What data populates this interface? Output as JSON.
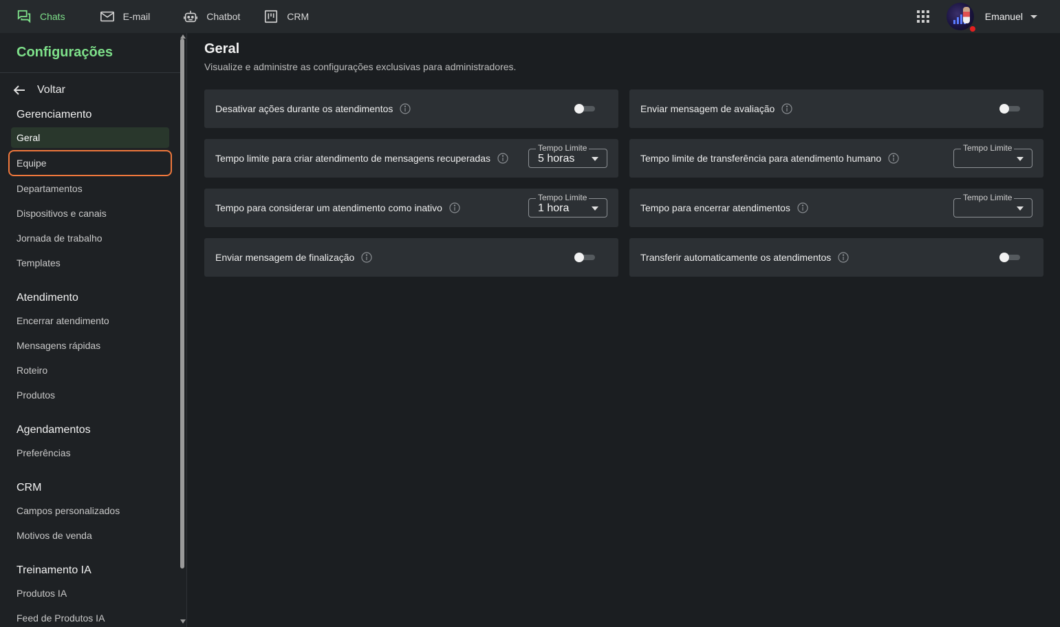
{
  "topbar": {
    "items": [
      {
        "label": "Chats",
        "icon": "chat-bubbles-icon",
        "active": true
      },
      {
        "label": "E-mail",
        "icon": "mail-icon",
        "active": false
      },
      {
        "label": "Chatbot",
        "icon": "robot-icon",
        "active": false
      },
      {
        "label": "CRM",
        "icon": "kanban-icon",
        "active": false
      }
    ],
    "user_name": "Emanuel"
  },
  "sidebar": {
    "title": "Configurações",
    "back_label": "Voltar",
    "sections": [
      {
        "title": "Gerenciamento",
        "items": [
          "Geral",
          "Equipe",
          "Departamentos",
          "Dispositivos e canais",
          "Jornada de trabalho",
          "Templates"
        ]
      },
      {
        "title": "Atendimento",
        "items": [
          "Encerrar atendimento",
          "Mensagens rápidas",
          "Roteiro",
          "Produtos"
        ]
      },
      {
        "title": "Agendamentos",
        "items": [
          "Preferências"
        ]
      },
      {
        "title": "CRM",
        "items": [
          "Campos personalizados",
          "Motivos de venda"
        ]
      },
      {
        "title": "Treinamento IA",
        "items": [
          "Produtos IA",
          "Feed de Produtos IA"
        ]
      }
    ],
    "selected_item": "Geral",
    "highlighted_item": "Equipe"
  },
  "main": {
    "title": "Geral",
    "subtitle": "Visualize e administre as configurações exclusivas para administradores.",
    "settings": [
      {
        "label": "Desativar ações durante os atendimentos",
        "control": "toggle",
        "enabled": false
      },
      {
        "label": "Enviar mensagem de avaliação",
        "control": "toggle",
        "enabled": false
      },
      {
        "label": "Tempo limite para criar atendimento de mensagens recuperadas",
        "control": "select",
        "select_label": "Tempo Limite",
        "value": "5 horas"
      },
      {
        "label": "Tempo limite de transferência para atendimento humano",
        "control": "select",
        "select_label": "Tempo Limite",
        "value": ""
      },
      {
        "label": "Tempo para considerar um atendimento como inativo",
        "control": "select",
        "select_label": "Tempo Limite",
        "value": "1 hora"
      },
      {
        "label": "Tempo para encerrar atendimentos",
        "control": "select",
        "select_label": "Tempo Limite",
        "value": ""
      },
      {
        "label": "Enviar mensagem de finalização",
        "control": "toggle",
        "enabled": false
      },
      {
        "label": "Transferir automaticamente os atendimentos",
        "control": "toggle",
        "enabled": false
      }
    ]
  },
  "colors": {
    "accent": "#7ee08a",
    "highlight_border": "#f0783c",
    "card_bg": "#2c3034",
    "page_bg": "#1b1e21",
    "topbar_bg": "#262a2d"
  }
}
